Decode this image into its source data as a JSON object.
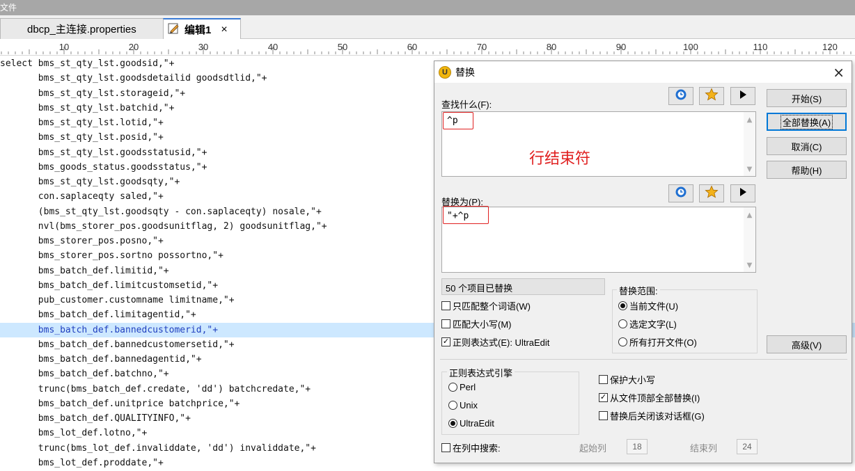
{
  "menu": {
    "file": "文件"
  },
  "tabs": [
    {
      "label": "dbcp_主连接.properties"
    },
    {
      "label": "编辑1",
      "close": "×"
    }
  ],
  "ruler": {
    "labels": [
      "10",
      "20",
      "30",
      "40",
      "50",
      "60",
      "70",
      "80",
      "90",
      "100",
      "110",
      "120"
    ]
  },
  "code_lines": [
    "select bms_st_qty_lst.goodsid,\"+",
    "       bms_st_qty_lst.goodsdetailid goodsdtlid,\"+",
    "       bms_st_qty_lst.storageid,\"+",
    "       bms_st_qty_lst.batchid,\"+",
    "       bms_st_qty_lst.lotid,\"+",
    "       bms_st_qty_lst.posid,\"+",
    "       bms_st_qty_lst.goodsstatusid,\"+",
    "       bms_goods_status.goodsstatus,\"+",
    "       bms_st_qty_lst.goodsqty,\"+",
    "       con.saplaceqty saled,\"+",
    "       (bms_st_qty_lst.goodsqty - con.saplaceqty) nosale,\"+",
    "       nvl(bms_storer_pos.goodsunitflag, 2) goodsunitflag,\"+",
    "       bms_storer_pos.posno,\"+",
    "       bms_storer_pos.sortno possortno,\"+",
    "       bms_batch_def.limitid,\"+",
    "       bms_batch_def.limitcustomsetid,\"+",
    "       pub_customer.customname limitname,\"+",
    "       bms_batch_def.limitagentid,\"+",
    "       bms_batch_def.bannedcustomerid,\"+",
    "       bms_batch_def.bannedcustomersetid,\"+",
    "       bms_batch_def.bannedagentid,\"+",
    "       bms_batch_def.batchno,\"+",
    "       trunc(bms_batch_def.credate, 'dd') batchcredate,\"+",
    "       bms_batch_def.unitprice batchprice,\"+",
    "       bms_batch_def.QUALITYINFO,\"+",
    "       bms_lot_def.lotno,\"+",
    "       trunc(bms_lot_def.invaliddate, 'dd') invaliddate,\"+",
    "       bms_lot_def.proddate,\"+"
  ],
  "highlight_line_index": 18,
  "dialog": {
    "title": "替换",
    "close": "×",
    "find_label": "查找什么(F):",
    "find_value": "^p",
    "annotation": "行结束符",
    "replace_label": "替换为(P):",
    "replace_value": "\"+^p",
    "status": "50 个项目已替换",
    "buttons": {
      "start": "开始(S)",
      "replace_all": "全部替换(A)",
      "cancel": "取消(C)",
      "help": "帮助(H)",
      "advanced": "高级(V)"
    },
    "options": {
      "whole_word": {
        "label": "只匹配整个词语(W)",
        "checked": false
      },
      "match_case": {
        "label": "匹配大小写(M)",
        "checked": false
      },
      "regex": {
        "label": "正则表达式(E): UltraEdit",
        "checked": true
      }
    },
    "scope": {
      "title": "替换范围:",
      "items": [
        {
          "label": "当前文件(U)",
          "selected": true
        },
        {
          "label": "选定文字(L)",
          "selected": false
        },
        {
          "label": "所有打开文件(O)",
          "selected": false
        }
      ]
    },
    "engine": {
      "title": "正则表达式引擎",
      "items": [
        {
          "label": "Perl",
          "selected": false
        },
        {
          "label": "Unix",
          "selected": false
        },
        {
          "label": "UltraEdit",
          "selected": true
        }
      ]
    },
    "extra": {
      "preserve_case": {
        "label": "保护大小写",
        "checked": false
      },
      "from_top": {
        "label": "从文件顶部全部替换(I)",
        "checked": true
      },
      "close_after": {
        "label": "替换后关闭该对话框(G)",
        "checked": false
      }
    },
    "column_search": {
      "label": "在列中搜索:",
      "checked": false,
      "start_label": "起始列",
      "start_value": "18",
      "end_label": "结束列",
      "end_value": "24"
    }
  },
  "colors": {
    "highlight_bg": "#cde8ff",
    "highlight_text": "#1f3fbf",
    "annotation": "#e02020",
    "accent": "#0078d7"
  }
}
